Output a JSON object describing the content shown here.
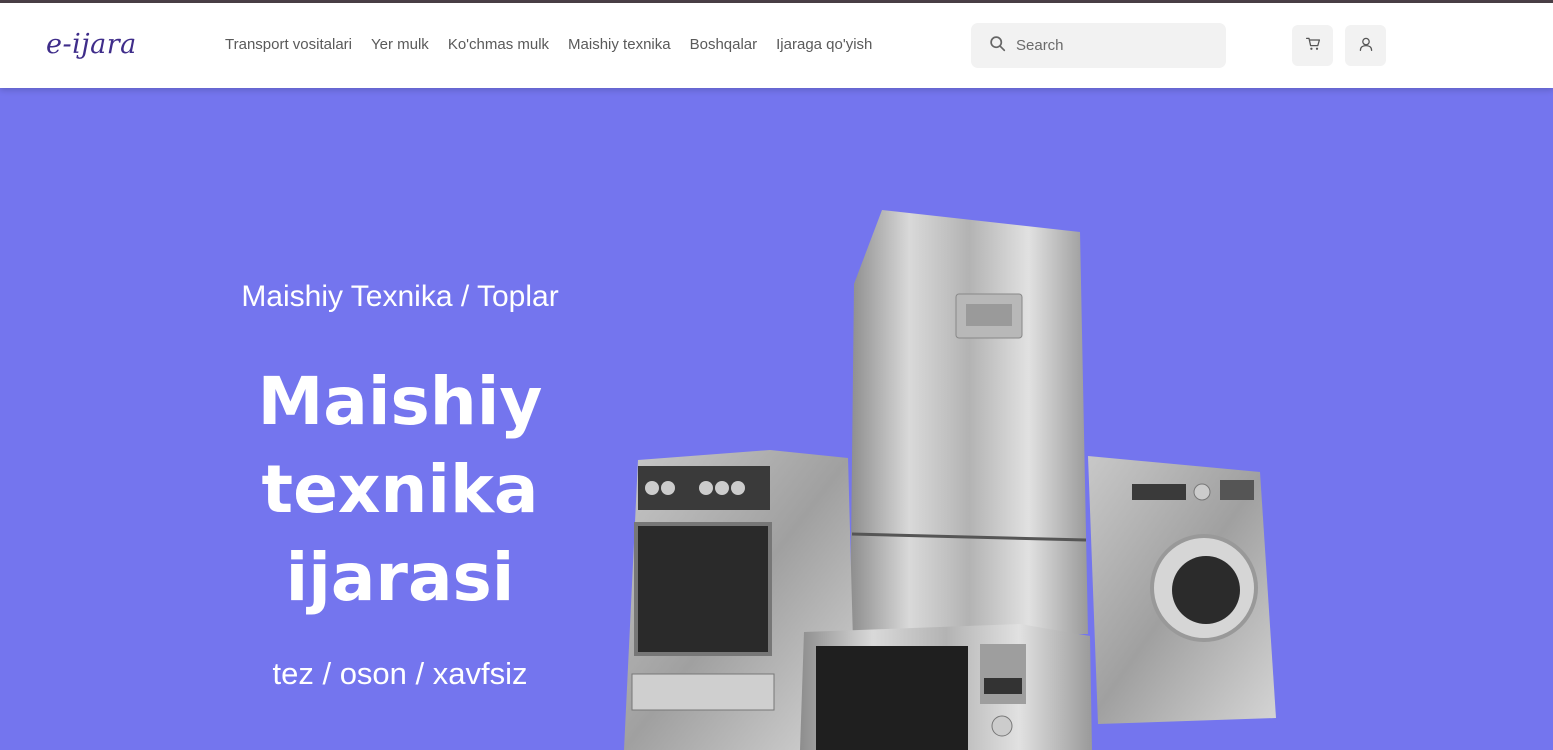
{
  "brand": {
    "logo_text": "e-ijara"
  },
  "nav": {
    "items": [
      {
        "label": "Transport vositalari"
      },
      {
        "label": "Yer mulk"
      },
      {
        "label": "Ko'chmas mulk"
      },
      {
        "label": "Maishiy texnika"
      },
      {
        "label": "Boshqalar"
      },
      {
        "label": "Ijaraga qo'yish"
      }
    ]
  },
  "search": {
    "placeholder": "Search",
    "icon": "search-icon"
  },
  "actions": {
    "cart_icon": "cart-icon",
    "user_icon": "user-icon"
  },
  "hero": {
    "breadcrumb": "Maishiy Texnika / Toplar",
    "headline_line1": "Maishiy",
    "headline_line2": "texnika",
    "headline_line3": "ijarasi",
    "tagline": "tez / oson / xavfsiz",
    "background_color": "#7475ee"
  },
  "colors": {
    "brand": "#3f2d8a",
    "hero": "#7475ee",
    "header_bg": "#ffffff"
  }
}
